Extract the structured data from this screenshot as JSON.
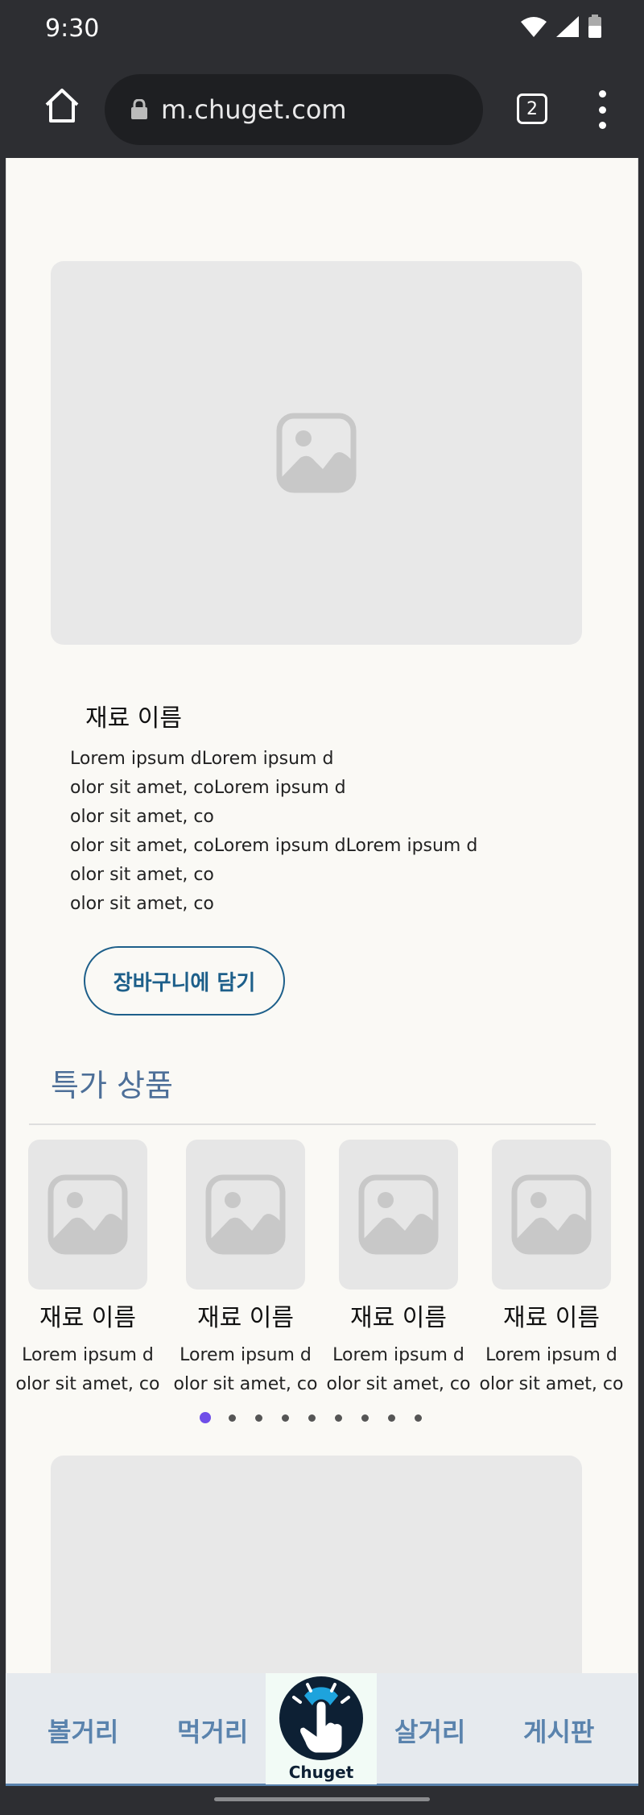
{
  "status_bar": {
    "time": "9:30"
  },
  "browser": {
    "url": "m.chuget.com",
    "tab_count": "2"
  },
  "hero": {
    "title": "재료 이름",
    "description_lines": [
      "Lorem ipsum dLorem ipsum d",
      "olor sit amet, coLorem ipsum d",
      "olor sit amet, co",
      "olor sit amet, coLorem ipsum dLorem ipsum d",
      "olor sit amet, co",
      "olor sit amet, co"
    ],
    "cart_button": "장바구니에 담기"
  },
  "specials": {
    "title": "특가 상품",
    "products": [
      {
        "name": "재료 이름",
        "desc": "Lorem ipsum d\nolor sit amet, co"
      },
      {
        "name": "재료 이름",
        "desc": "Lorem ipsum d\nolor sit amet, co"
      },
      {
        "name": "재료 이름",
        "desc": "Lorem ipsum d\nolor sit amet, co"
      },
      {
        "name": "재료 이름",
        "desc": "Lorem ipsum d\nolor sit amet, co"
      }
    ],
    "pagination": {
      "total": 9,
      "active": 1
    }
  },
  "bottom_nav": {
    "items": [
      "볼거리",
      "먹거리",
      "살거리",
      "게시판"
    ],
    "logo_text": "Chuget"
  },
  "colors": {
    "accent": "#5a83ad",
    "dot_active": "#6f4ee8",
    "button": "#1d5f8a"
  }
}
